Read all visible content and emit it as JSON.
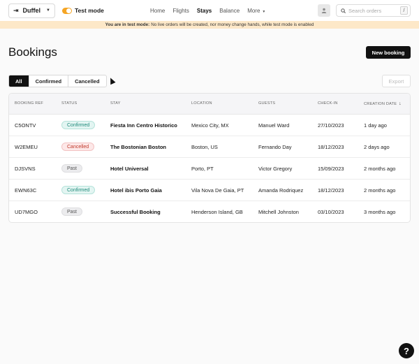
{
  "topbar": {
    "org_name": "Duffel",
    "test_mode_label": "Test mode",
    "nav": [
      {
        "label": "Home",
        "active": false
      },
      {
        "label": "Flights",
        "active": false
      },
      {
        "label": "Stays",
        "active": true
      },
      {
        "label": "Balance",
        "active": false
      },
      {
        "label": "More",
        "active": false
      }
    ],
    "search_placeholder": "Search orders",
    "search_shortcut": "/"
  },
  "banner": {
    "strong": "You are in test mode:",
    "text": "No live orders will be created, nor money change hands, while test mode is enabled"
  },
  "page": {
    "title": "Bookings",
    "new_booking_label": "New booking",
    "export_label": "Export",
    "filters": [
      {
        "label": "All",
        "active": true
      },
      {
        "label": "Confirmed",
        "active": false
      },
      {
        "label": "Cancelled",
        "active": false
      }
    ]
  },
  "table": {
    "columns": [
      "BOOKING REF",
      "STATUS",
      "STAY",
      "LOCATION",
      "GUESTS",
      "CHECK-IN",
      "CREATION DATE"
    ],
    "rows": [
      {
        "ref": "C5ONTV",
        "status": "Confirmed",
        "status_kind": "confirmed",
        "stay": "Fiesta Inn Centro Historico",
        "location": "Mexico City, MX",
        "guest": "Manuel Ward",
        "checkin": "27/10/2023",
        "created": "1 day ago"
      },
      {
        "ref": "W2EMEU",
        "status": "Cancelled",
        "status_kind": "cancelled",
        "stay": "The Bostonian Boston",
        "location": "Boston, US",
        "guest": "Fernando Day",
        "checkin": "18/12/2023",
        "created": "2 days ago"
      },
      {
        "ref": "DJSVNS",
        "status": "Past",
        "status_kind": "past",
        "stay": "Hotel Universal",
        "location": "Porto, PT",
        "guest": "Victor Gregory",
        "checkin": "15/09/2023",
        "created": "2 months ago"
      },
      {
        "ref": "EWN63C",
        "status": "Confirmed",
        "status_kind": "confirmed",
        "stay": "Hotel ibis Porto Gaia",
        "location": "Vila Nova De Gaia, PT",
        "guest": "Amanda Rodriquez",
        "checkin": "18/12/2023",
        "created": "2 months ago"
      },
      {
        "ref": "UD7MGO",
        "status": "Past",
        "status_kind": "past",
        "stay": "Successful Booking",
        "location": "Henderson Island, GB",
        "guest": "Mitchell Johnston",
        "checkin": "03/10/2023",
        "created": "3 months ago"
      }
    ]
  },
  "help_label": "?"
}
